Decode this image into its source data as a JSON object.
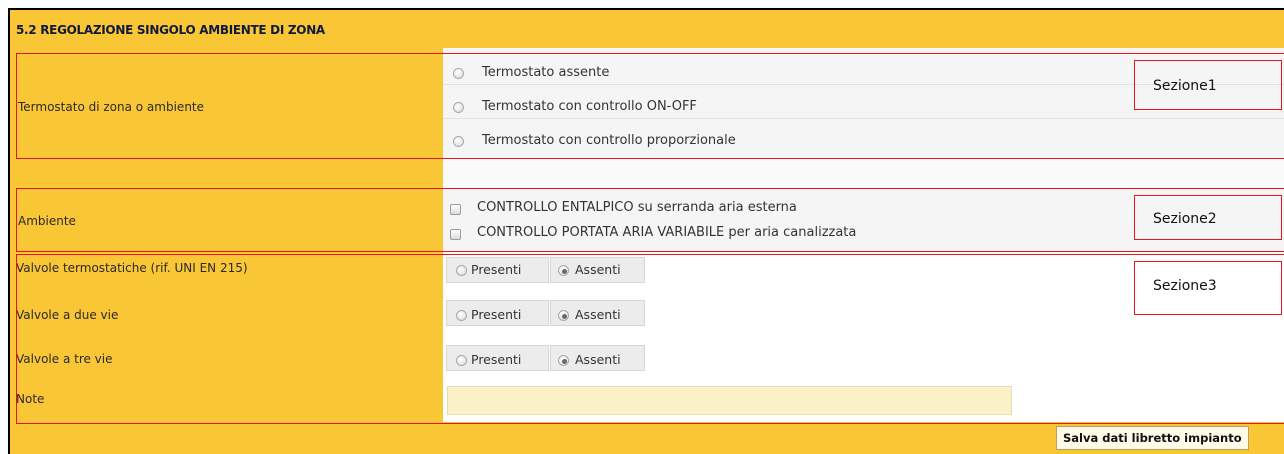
{
  "section_title": "5.2 REGOLAZIONE SINGOLO AMBIENTE DI ZONA",
  "thermostat": {
    "label": "Termostato di zona o ambiente",
    "options": [
      {
        "label": "Termostato assente",
        "selected": false
      },
      {
        "label": "Termostato con controllo ON-OFF",
        "selected": false
      },
      {
        "label": "Termostato con controllo proporzionale",
        "selected": false
      }
    ]
  },
  "ambiente": {
    "label": "Ambiente",
    "options": [
      {
        "label": "CONTROLLO ENTALPICO su serranda aria esterna",
        "checked": false
      },
      {
        "label": "CONTROLLO PORTATA ARIA VARIABILE per aria canalizzata",
        "checked": false
      }
    ]
  },
  "valves": {
    "option_present": "Presenti",
    "option_absent": "Assenti",
    "rows": [
      {
        "label": "Valvole termostatiche (rif. UNI EN 215)",
        "value": "Assenti"
      },
      {
        "label": "Valvole a due vie",
        "value": "Assenti"
      },
      {
        "label": "Valvole a tre vie",
        "value": "Assenti"
      }
    ]
  },
  "note": {
    "label": "Note",
    "value": ""
  },
  "annotations": [
    "Sezione1",
    "Sezione2",
    "Sezione3"
  ],
  "save_button": "Salva dati libretto impianto",
  "colors": {
    "accent_yellow": "#f9c636",
    "annotation_red": "#e8141b",
    "note_field": "#faf1c6"
  }
}
